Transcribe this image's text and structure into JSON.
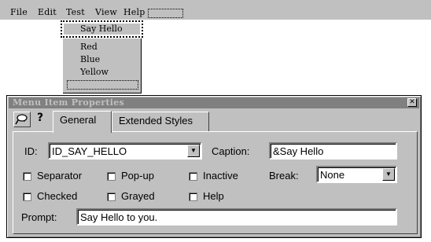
{
  "menubar": {
    "items": [
      "File",
      "Edit",
      "Test",
      "View",
      "Help"
    ]
  },
  "dropdown": {
    "selected_item": "Say Hello",
    "items": [
      "Red",
      "Blue",
      "Yellow"
    ]
  },
  "dialog": {
    "title": "Menu Item Properties",
    "tabs": [
      "General",
      "Extended Styles"
    ],
    "id_label": "ID:",
    "id_value": "ID_SAY_HELLO",
    "caption_label": "Caption:",
    "caption_value": "&Say Hello",
    "checkboxes": [
      "Separator",
      "Pop-up",
      "Inactive",
      "Checked",
      "Grayed",
      "Help"
    ],
    "break_label": "Break:",
    "break_value": "None",
    "prompt_label": "Prompt:",
    "prompt_value": "Say Hello to you."
  }
}
